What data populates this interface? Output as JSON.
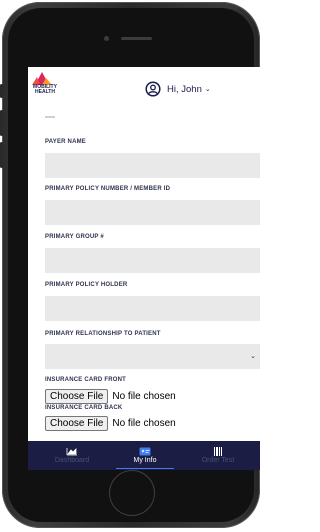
{
  "brand": {
    "logo_text": "MOBILITY HEALTH",
    "colors": {
      "magenta": "#e0245e",
      "orange": "#f59a23",
      "navy": "#1b1d44"
    }
  },
  "header": {
    "greeting": "Hi, John",
    "user_icon": "user-circle-icon",
    "dropdown_icon": "chevron-down-icon"
  },
  "form": {
    "fields": [
      {
        "label": "PAYER NAME",
        "value": ""
      },
      {
        "label": "PRIMARY POLICY NUMBER / MEMBER ID",
        "value": ""
      },
      {
        "label": "PRIMARY GROUP #",
        "value": ""
      },
      {
        "label": "PRIMARY POLICY HOLDER",
        "value": ""
      },
      {
        "label": "PRIMARY RELATIONSHIP TO PATIENT",
        "value": ""
      }
    ],
    "uploads": [
      {
        "label": "INSURANCE CARD FRONT",
        "button": "Choose File",
        "status": "No file chosen"
      },
      {
        "label": "INSURANCE CARD BACK",
        "button": "Choose File",
        "status": "No file chosen"
      }
    ]
  },
  "nav": {
    "items": [
      {
        "label": "Dashboard",
        "icon": "dashboard-icon",
        "active": false
      },
      {
        "label": "My Info",
        "icon": "id-card-icon",
        "active": true
      },
      {
        "label": "Order Test",
        "icon": "barcode-icon",
        "active": false
      }
    ]
  }
}
